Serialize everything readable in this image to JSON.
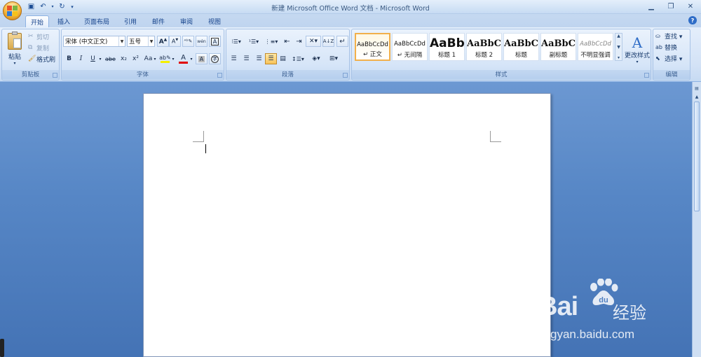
{
  "window": {
    "title": "新建 Microsoft Office Word 文档 - Microsoft Word",
    "controls": [
      "minimize",
      "restore",
      "close"
    ]
  },
  "quick_access": [
    {
      "icon": "save-icon",
      "glyph": "💾"
    },
    {
      "icon": "undo-icon",
      "glyph": "↶"
    },
    {
      "icon": "redo-icon",
      "glyph": "↻"
    },
    {
      "icon": "customize-icon",
      "glyph": "▾"
    }
  ],
  "tabs": [
    "开始",
    "插入",
    "页面布局",
    "引用",
    "邮件",
    "审阅",
    "视图"
  ],
  "active_tab": "开始",
  "clipboard": {
    "paste": "粘贴",
    "cut": "剪切",
    "copy": "复制",
    "format_painter": "格式刷",
    "label": "剪贴板"
  },
  "font": {
    "font_name": "宋体 (中文正文)",
    "font_size": "五号",
    "grow": "A",
    "shrink": "A",
    "bold": "B",
    "italic": "I",
    "underline": "U",
    "strike": "abe",
    "subscript": "x₂",
    "superscript": "x²",
    "change_case": "Aa",
    "label": "字体",
    "font_color": "#e00000",
    "highlight_color": "#f5f000"
  },
  "paragraph": {
    "label": "段落"
  },
  "styles": {
    "label": "样式",
    "items": [
      {
        "preview": "AaBbCcDd",
        "name": "↵ 正文",
        "selected": true
      },
      {
        "preview": "AaBbCcDd",
        "name": "↵ 无间隔",
        "selected": false
      },
      {
        "preview": "AaBb",
        "name": "标题 1",
        "selected": false
      },
      {
        "preview": "AaBbC",
        "name": "标题 2",
        "selected": false
      },
      {
        "preview": "AaBbC",
        "name": "标题",
        "selected": false
      },
      {
        "preview": "AaBbC",
        "name": "副标题",
        "selected": false
      },
      {
        "preview": "AaBbCcDd",
        "name": "不明显强调",
        "selected": false
      }
    ],
    "change_styles": "更改样式"
  },
  "editing": {
    "find": "查找 ▾",
    "replace": "替换",
    "select": "选择 ▾",
    "label": "编辑"
  },
  "watermark": {
    "brand": "Bai",
    "brand_tail": "du",
    "product": "经验",
    "url": "jingyan.baidu.com"
  },
  "colors": {
    "accent": "#15428b",
    "ribbon": "#d3e2f6",
    "doc_bg": "#5787c6"
  }
}
